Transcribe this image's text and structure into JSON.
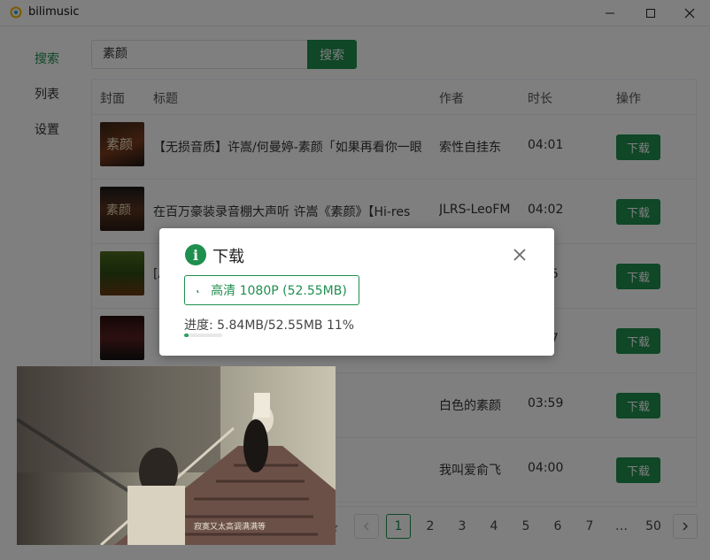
{
  "window": {
    "title": "bilimusic"
  },
  "nav": {
    "items": [
      "搜索",
      "列表",
      "设置"
    ],
    "active": 0
  },
  "search": {
    "value": "素颜",
    "button": "搜索"
  },
  "table": {
    "headers": {
      "cover": "封面",
      "title": "标题",
      "author": "作者",
      "duration": "时长",
      "action": "操作"
    },
    "rows": [
      {
        "title": "【无损音质】许嵩/何曼婷-素颜「如果再看你一眼",
        "author": "索性自挂东",
        "duration": "04:01",
        "action": "下载",
        "cover_text": "素颜"
      },
      {
        "title": "在百万豪装录音棚大声听 许嵩《素颜》【Hi-res",
        "author": "JLRS-LeoFM",
        "duration": "04:02",
        "action": "下载",
        "cover_text": "素颜"
      },
      {
        "title": "[A",
        "author": "",
        "duration": "5",
        "action": "下载",
        "cover_text": ""
      },
      {
        "title": "",
        "author": "",
        "duration": "7",
        "action": "下载",
        "cover_text": ""
      },
      {
        "title": "",
        "author": "白色的素颜",
        "duration": "03:59",
        "action": "下载",
        "cover_text": ""
      },
      {
        "title": "",
        "author": "我叫爱俞飞",
        "duration": "04:00",
        "action": "下载",
        "cover_text": ""
      }
    ]
  },
  "pagination": {
    "partial_left": "条",
    "pages": [
      "1",
      "2",
      "3",
      "4",
      "5",
      "6",
      "7",
      "…",
      "50"
    ],
    "current": "1"
  },
  "dialog": {
    "title": "下载",
    "quality_button": "高清 1080P (52.55MB)",
    "progress_label": "进度:",
    "progress_value": "5.84MB/52.55MB 11%",
    "progress_fraction": 0.11
  },
  "video": {
    "subtitle": "寂寞又太高调满满等"
  },
  "colors": {
    "accent": "#1e8f4e",
    "mask": "rgba(0,0,0,0.5)"
  },
  "icons": {
    "app": "bilimusic-logo-icon",
    "close": "close-icon",
    "info": "info-icon"
  }
}
